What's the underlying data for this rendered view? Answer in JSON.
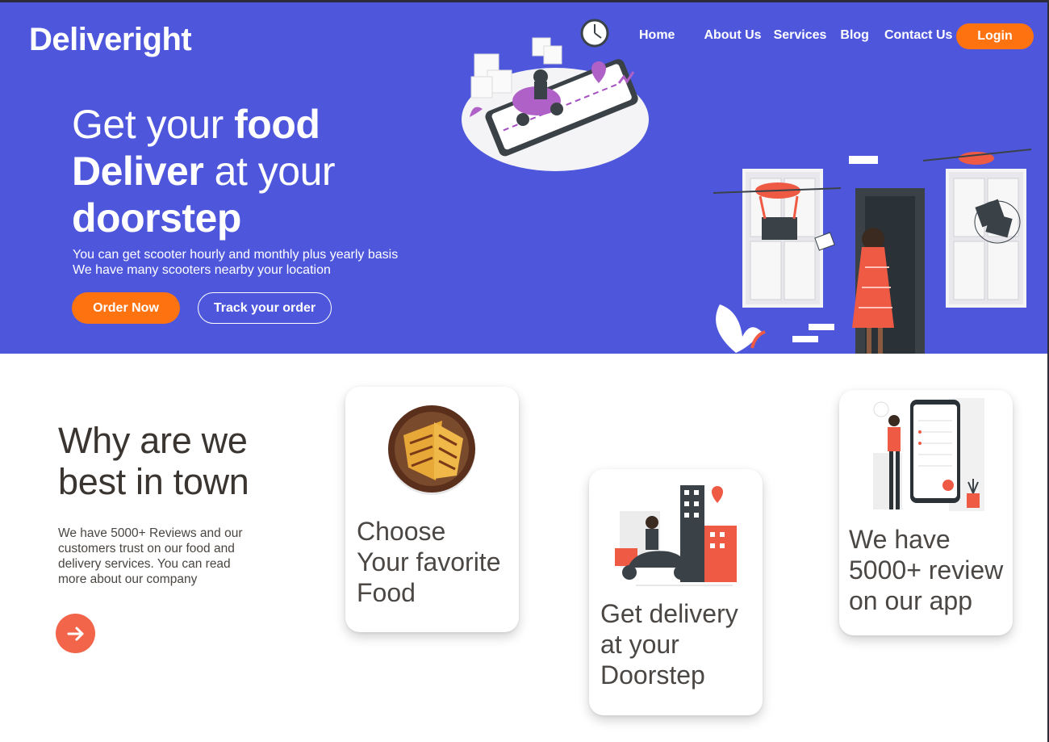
{
  "brand": {
    "name": "Deliveright"
  },
  "nav": {
    "items": [
      "Home",
      "About Us",
      "Services",
      "Blog",
      "Contact Us"
    ],
    "login_label": "Login"
  },
  "hero": {
    "line1_light": "Get your ",
    "line1_bold": "food",
    "line2_bold": "Deliver",
    "line2_light": " at your",
    "line3_bold": "doorstep",
    "sub1": "You can get scooter hourly and monthly plus yearly basis",
    "sub2": "We have many scooters nearby your location",
    "order_label": "Order Now",
    "track_label": "Track your order"
  },
  "why": {
    "title_line1": "Why are we",
    "title_line2": "best in town",
    "text": "We have 5000+ Reviews and our customers trust on our food and delivery services. You can read more about our company"
  },
  "cards": [
    {
      "line1": "Choose",
      "line2": "Your favorite",
      "line3": "Food"
    },
    {
      "line1": "Get delivery",
      "line2": "at your",
      "line3": "Doorstep"
    },
    {
      "line1": "We have",
      "line2": "5000+ review",
      "line3": "on our app"
    }
  ],
  "icons": [
    "arrow-right-icon"
  ],
  "colors": {
    "hero_bg": "#4e57dc",
    "accent": "#ff7210",
    "arrow": "#f2654a"
  }
}
